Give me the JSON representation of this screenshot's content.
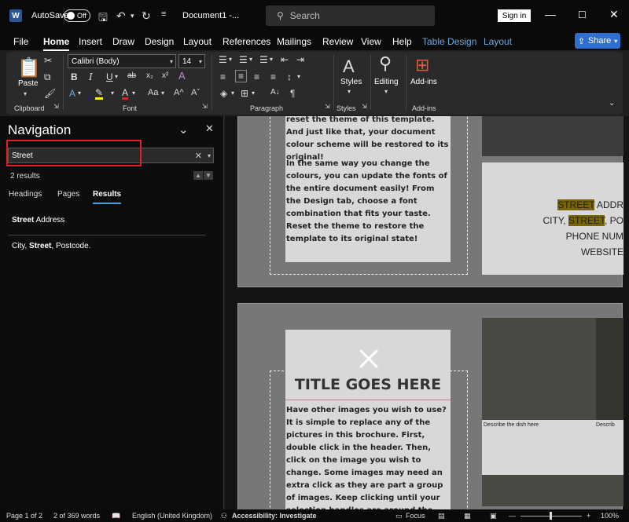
{
  "titlebar": {
    "logo": "W",
    "autosave_label": "AutoSave",
    "autosave_state": "Off",
    "doc_title": "Document1  -...",
    "search_placeholder": "Search",
    "signin_label": "Sign in"
  },
  "menu": {
    "tabs": [
      "File",
      "Home",
      "Insert",
      "Draw",
      "Design",
      "Layout",
      "References",
      "Mailings",
      "Review",
      "View",
      "Help",
      "Table Design",
      "Layout"
    ],
    "share_label": "Share"
  },
  "ribbon": {
    "paste_label": "Paste",
    "font_name": "Calibri (Body)",
    "font_size": "14",
    "styles_label": "Styles",
    "editing_label": "Editing",
    "addins_label": "Add-ins",
    "groups": [
      "Clipboard",
      "Font",
      "Paragraph",
      "Styles",
      "Add-ins"
    ]
  },
  "navigation": {
    "title": "Navigation",
    "search_value": "Street",
    "results_count": "2 results",
    "tabs": [
      "Headings",
      "Pages",
      "Results"
    ],
    "results": [
      {
        "bold": "Street",
        "rest": " Address"
      },
      {
        "prefix": "City, ",
        "bold": "Street",
        "rest": ", Postcode."
      }
    ]
  },
  "document": {
    "page1_para1": "reset the theme of this template. And just like that, your document colour scheme will be restored to its original!",
    "page1_para2": "In the same way you change the colours, you can update the fonts of the entire document easily! From the Design tab, choose a font combination that fits your taste. Reset the theme to restore the template to its original state!",
    "address_street": "STREET",
    "address_line1_rest": " ADDR",
    "address_city": "CITY, ",
    "address_line2_rest": ", PO",
    "address_phone": "PHONE NUM",
    "address_website": "WEBSITE",
    "title": "TITLE GOES HERE",
    "page2_para": "Have other images you wish to use? It is simple to replace any of the pictures in this brochure. First, double click in the header. Then, click on the image you wish to change. Some images may need an extra click as they are part a group of images. Keep clicking until your selection handles are around the one image you",
    "caption1": "Describe the dish here",
    "caption2": "Describ"
  },
  "statusbar": {
    "page": "Page 1 of 2",
    "words": "2 of 369 words",
    "language": "English (United Kingdom)",
    "accessibility": "Accessibility: Investigate",
    "focus": "Focus",
    "zoom": "100%"
  }
}
